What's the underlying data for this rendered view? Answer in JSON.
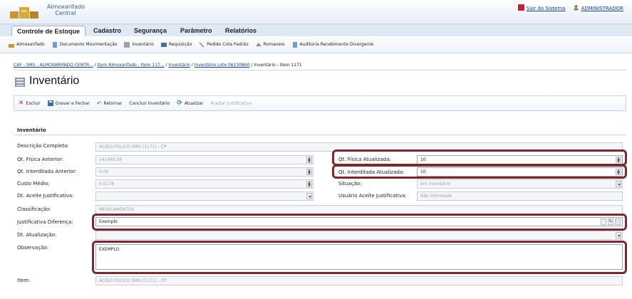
{
  "app": {
    "title": "Almoxarifado Central"
  },
  "header": {
    "exit_label": "Sair do Sistema",
    "user_label": "ADMINISTRADOR"
  },
  "tabs": [
    "Controle de Estoque",
    "Cadastro",
    "Segurança",
    "Parâmetro",
    "Relatórios"
  ],
  "subnav": [
    "Almoxarifado",
    "Documento Movimentação",
    "Inventário",
    "Requisição",
    "Pedido Cota Padrão",
    "Romaneio",
    "Auditoria Recebimento Divergente"
  ],
  "breadcrumb": {
    "items": [
      "CAF - SMS - ALMOXARIFADO CENTR...",
      "Item Almoxarifado - Item 117...",
      "Inventário",
      "Inventário Lote 06130860"
    ],
    "current": "Inventário - Item 1171"
  },
  "page": {
    "title": "Inventário"
  },
  "actions": {
    "delete": "Excluir",
    "save_close": "Gravar e Fechar",
    "back": "Retornar",
    "conclude": "Concluir Inventário",
    "update": "Atualizar",
    "accept_just": "Aceitar Justificativa"
  },
  "form": {
    "section": "Inventário",
    "descricao": {
      "label": "Descrição Completa:",
      "value": "ACIDO FOLICO 5MG (1171) - CP"
    },
    "qt_fisica_anterior": {
      "label": "Qt. Física Anterior:",
      "value": "341480,00"
    },
    "qt_interditada_anterior": {
      "label": "Qt. Interditada Anterior:",
      "value": "0,00"
    },
    "custo_medio": {
      "label": "Custo Médio:",
      "value": "0,0178"
    },
    "dt_aceite": {
      "label": "Dt. Aceite Justificativa:",
      "value": ""
    },
    "classificacao": {
      "label": "Classificação:",
      "value": "MEDICAMENTOS"
    },
    "justificativa": {
      "label": "Justificativa Diferença:",
      "value": "Exemplo"
    },
    "dt_atualizacao": {
      "label": "Dt. Atualização:",
      "value": ""
    },
    "observacao": {
      "label": "Observação:",
      "value": "EXEMPLO."
    },
    "item": {
      "label": "Item:",
      "value": "ACIDO FOLICO 5MG (1171) - CP"
    },
    "qt_fisica_atualizada": {
      "label": "Qt. Física Atualizada:",
      "value": "10"
    },
    "qt_interditada_atualizada": {
      "label": "Qt. Interditada Atualizada:",
      "value": "10"
    },
    "situacao": {
      "label": "Situação:",
      "value": "Em inventário"
    },
    "usuario_aceite": {
      "label": "Usuário Aceite Justificativa:",
      "value": "Não Informado"
    }
  },
  "colors": {
    "highlight": "#7a2a2e",
    "link": "#1a3f9a",
    "tab_bg": "#dfe8f5"
  }
}
